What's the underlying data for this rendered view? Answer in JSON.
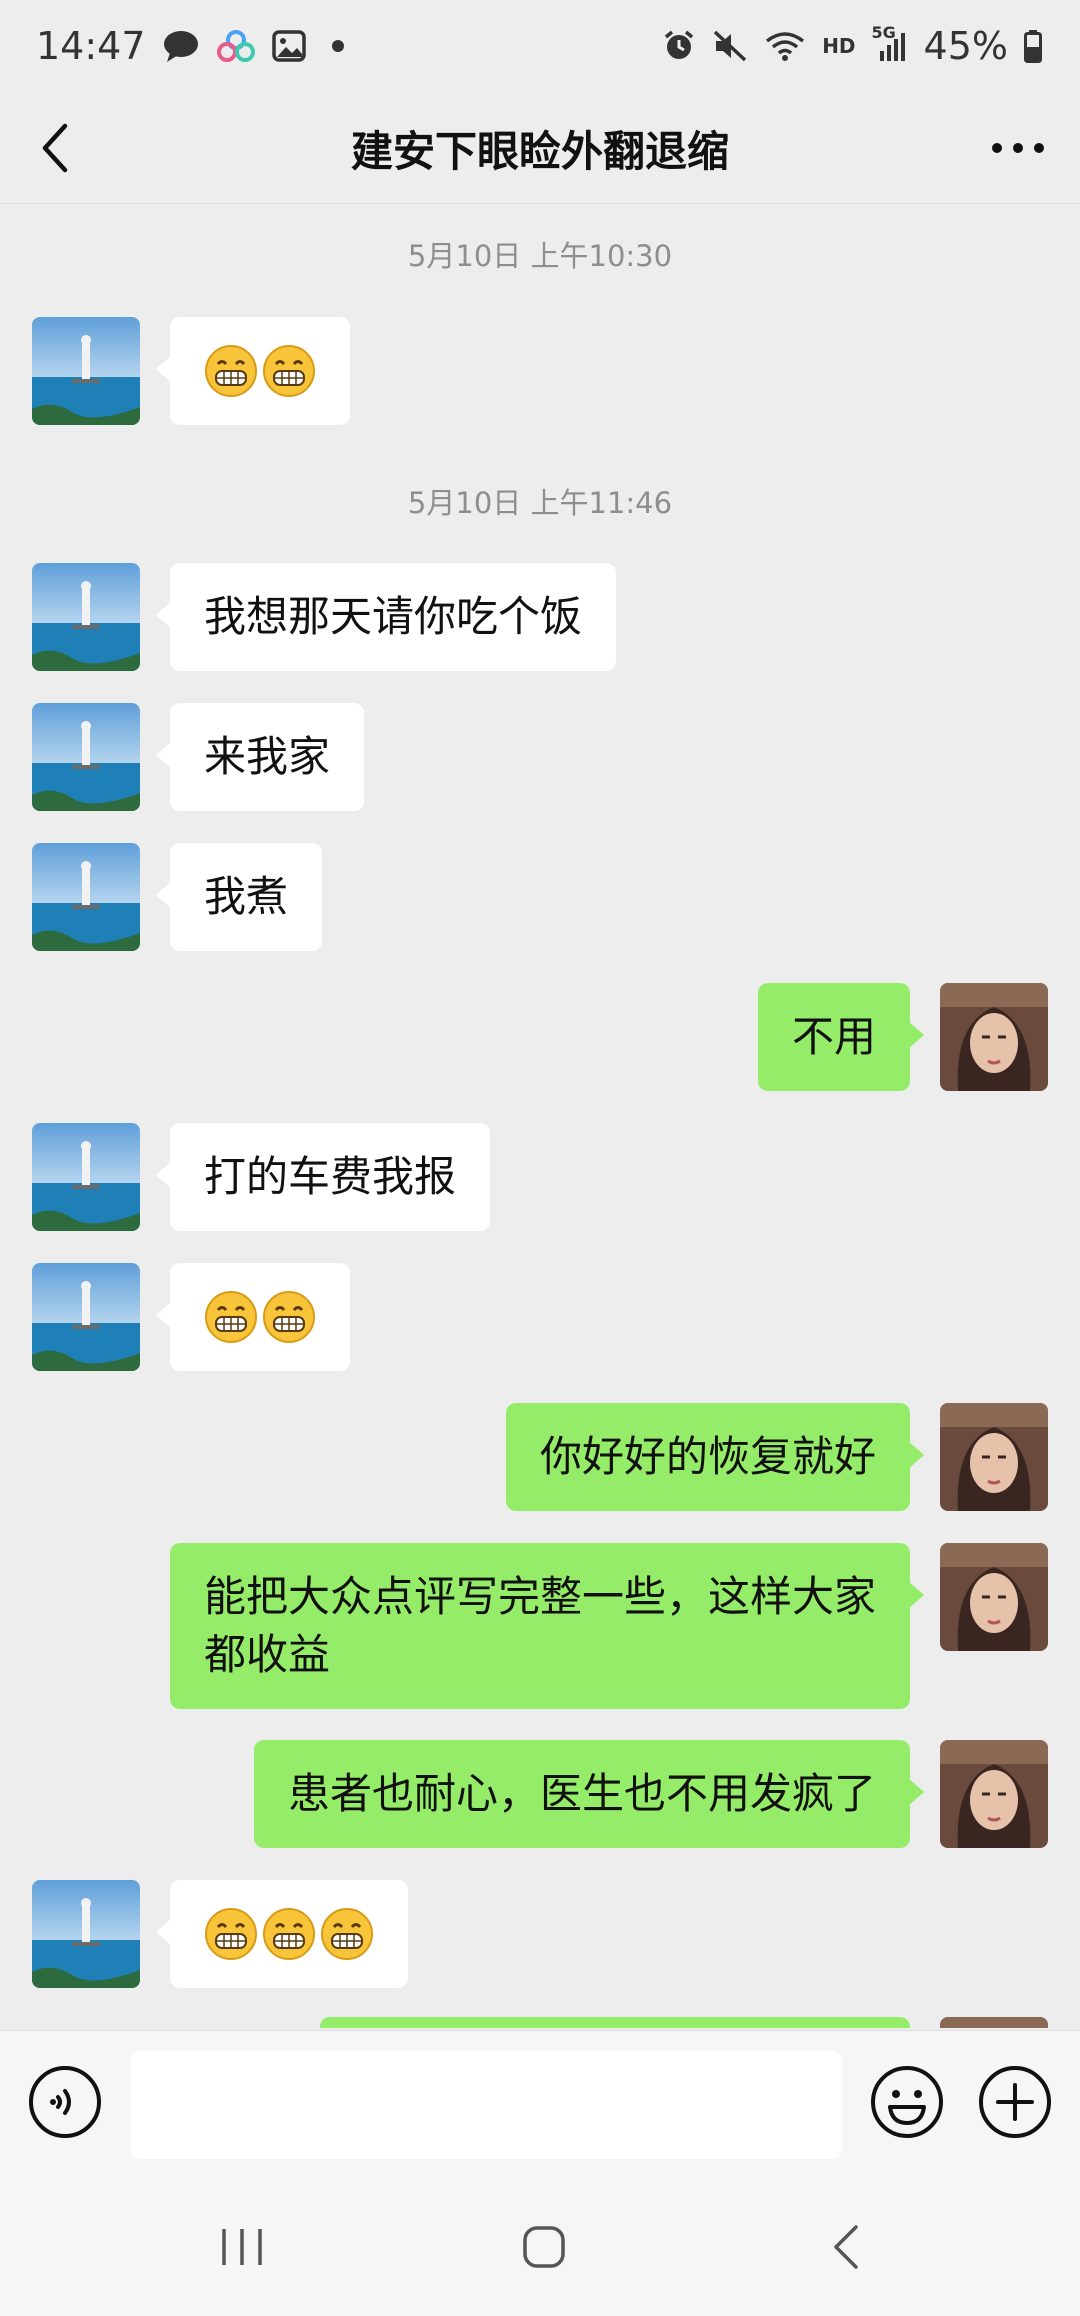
{
  "status_bar": {
    "time": "14:47",
    "battery": "45%",
    "network_label": "HD",
    "signal_label": "5G"
  },
  "header": {
    "title": "建安下眼睑外翻退缩"
  },
  "messages": [
    {
      "type": "timestamp",
      "text": "5月10日 上午10:30"
    },
    {
      "type": "msg",
      "side": "in",
      "emoji_count": 2
    },
    {
      "type": "timestamp",
      "text": "5月10日 上午11:46"
    },
    {
      "type": "msg",
      "side": "in",
      "text": "我想那天请你吃个饭"
    },
    {
      "type": "msg",
      "side": "in",
      "text": "来我家"
    },
    {
      "type": "msg",
      "side": "in",
      "text": "我煮"
    },
    {
      "type": "msg",
      "side": "out",
      "text": "不用"
    },
    {
      "type": "msg",
      "side": "in",
      "text": "打的车费我报"
    },
    {
      "type": "msg",
      "side": "in",
      "emoji_count": 2
    },
    {
      "type": "msg",
      "side": "out",
      "text": "你好好的恢复就好"
    },
    {
      "type": "msg",
      "side": "out",
      "text": "能把大众点评写完整一些，这样大家都收益"
    },
    {
      "type": "msg",
      "side": "out",
      "text": "患者也耐心，医生也不用发疯了"
    },
    {
      "type": "msg",
      "side": "in",
      "emoji_count": 3
    }
  ],
  "input_bar": {
    "voice_icon": "voice-icon",
    "emoji_icon": "smiley-icon",
    "plus_icon": "plus-icon"
  },
  "colors": {
    "background": "#ededed",
    "bubble_out": "#95ec69",
    "bubble_in": "#ffffff",
    "timestamp": "#8e8e8e"
  }
}
